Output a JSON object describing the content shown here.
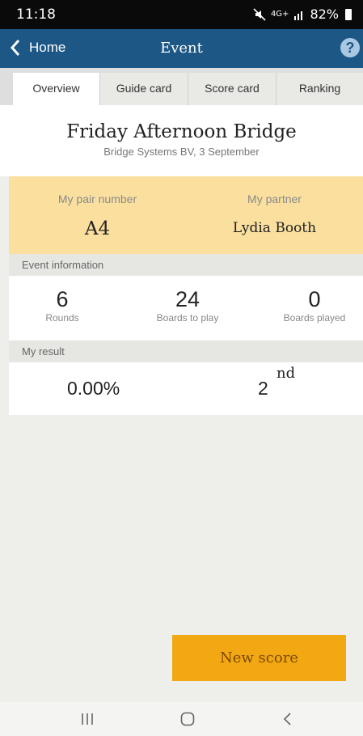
{
  "status_bar": {
    "time": "11:18",
    "network": "4G+",
    "battery": "82%"
  },
  "app_bar": {
    "back_label": "Home",
    "title": "Event",
    "help": "?"
  },
  "tabs": [
    {
      "label": "Overview",
      "active": true
    },
    {
      "label": "Guide card",
      "active": false
    },
    {
      "label": "Score card",
      "active": false
    },
    {
      "label": "Ranking",
      "active": false
    }
  ],
  "event": {
    "name": "Friday Afternoon Bridge",
    "subtitle": "Bridge Systems BV, 3 September"
  },
  "pair": {
    "pair_label": "My pair number",
    "pair_value": "A4",
    "partner_label": "My partner",
    "partner_value": "Lydia Booth"
  },
  "event_info": {
    "heading": "Event information",
    "stats": [
      {
        "value": "6",
        "label": "Rounds"
      },
      {
        "value": "24",
        "label": "Boards to play"
      },
      {
        "value": "0",
        "label": "Boards played"
      }
    ]
  },
  "result": {
    "heading": "My result",
    "percentage": "0.00%",
    "rank": "2",
    "rank_suffix": "nd"
  },
  "actions": {
    "new_score": "New score"
  },
  "colors": {
    "app_bar": "#1c5785",
    "highlight": "#fadf9f",
    "button": "#f2a812"
  }
}
